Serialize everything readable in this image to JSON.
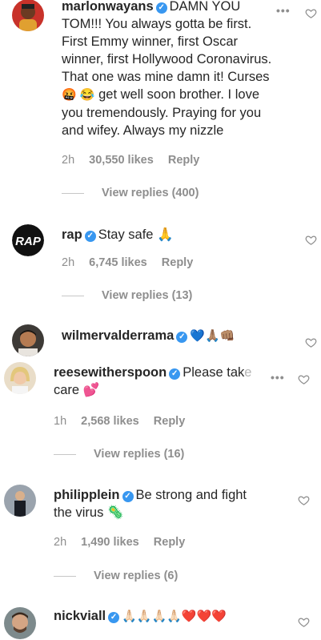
{
  "comments": [
    {
      "username": "marlonwayans",
      "text": "DAMN YOU TOM!!! You always gotta be first. First Emmy winner, first Oscar winner, first Hollywood Coronavirus. That one was mine damn it! Curses",
      "text_lines": [
        "DAMN YOU",
        "TOM!!! You always gotta be first.",
        "First Emmy winner, first Oscar",
        "winner, first Hollywood Coronavirus.",
        "That one was mine damn it! Curses"
      ],
      "emoji_line_emojis": "🤬 😂",
      "emoji_line_text": "get well soon brother. I love",
      "tail_lines": [
        "you tremendously. Praying for you",
        "and wifey. Always my nizzle"
      ],
      "time": "2h",
      "likes": "30,550 likes",
      "reply": "Reply",
      "view_replies": "View replies (400)"
    },
    {
      "username": "rap",
      "text": "Stay safe 🙏",
      "time": "2h",
      "likes": "6,745 likes",
      "reply": "Reply",
      "view_replies": "View replies (13)"
    },
    {
      "username": "wilmervalderrama",
      "text": "💙🙏🏽👊🏽"
    },
    {
      "username": "reesewitherspoon",
      "text_a": "Please tak",
      "text_a_fade": "e",
      "text_b": "care 💕",
      "time": "1h",
      "likes": "2,568 likes",
      "reply": "Reply",
      "view_replies": "View replies (16)"
    },
    {
      "username": "philipplein",
      "text_a": "Be strong and fight",
      "text_b": "the virus 🦠",
      "time": "2h",
      "likes": "1,490 likes",
      "reply": "Reply",
      "view_replies": "View replies (6)"
    },
    {
      "username": "nickviall",
      "text": "🙏🏻🙏🏻🙏🏻🙏🏻❤️❤️❤️"
    }
  ],
  "icons": {
    "verified": "verified-badge-icon",
    "heart": "heart-outline-icon",
    "more": "more-options-icon"
  },
  "colors": {
    "verified": "#3897f0",
    "muted": "#8e8e8e",
    "text": "#262626"
  }
}
